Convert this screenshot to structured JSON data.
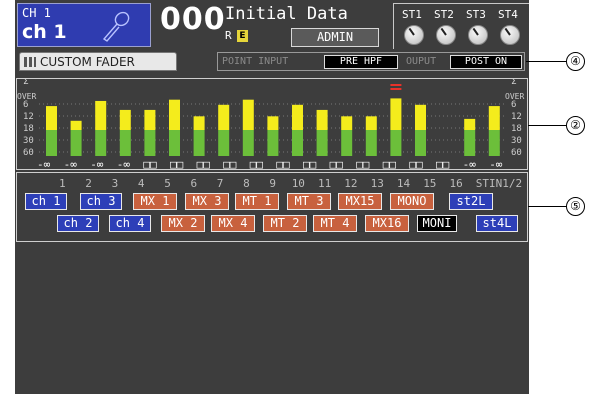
{
  "header": {
    "channel_number": "CH 1",
    "channel_name": "ch 1",
    "scene_number": "000",
    "scene_title": "Initial Data",
    "protect_mark": "R",
    "edit_badge": "E",
    "user_level": "ADMIN",
    "stereo_labels": [
      "ST1",
      "ST2",
      "ST3",
      "ST4"
    ]
  },
  "tab": {
    "label": "CUSTOM FADER"
  },
  "meter_point": {
    "input_label": "POINT INPUT",
    "input_value": "PRE HPF",
    "output_label": "OUPUT",
    "output_value": "POST ON"
  },
  "meter_scale": [
    "OVER",
    "6",
    "12",
    "18",
    "30",
    "60"
  ],
  "meter_scale_top": "Σ",
  "meters": {
    "levels": [
      0.78,
      0.55,
      0.86,
      0.72,
      0.72,
      0.88,
      0.62,
      0.8,
      0.88,
      0.62,
      0.8,
      0.72,
      0.62,
      0.62,
      0.9,
      0.8,
      0.0,
      0.58,
      0.78
    ],
    "peak_hold": [
      false,
      false,
      false,
      false,
      false,
      false,
      false,
      false,
      false,
      false,
      false,
      false,
      false,
      false,
      true,
      false,
      false,
      false,
      false
    ],
    "readouts": [
      "-∞",
      "-∞",
      "-∞",
      "-∞",
      "□□",
      "□□",
      "□□",
      "□□",
      "□□",
      "□□",
      "□□",
      "□□",
      "□□",
      "□□",
      "□□",
      "□□",
      "-∞",
      "-∞"
    ]
  },
  "channel_grid": {
    "numbers": [
      "1",
      "2",
      "3",
      "4",
      "5",
      "6",
      "7",
      "8",
      "9",
      "10",
      "11",
      "12",
      "13",
      "14",
      "15",
      "16",
      "STIN1/2"
    ],
    "row1": [
      "ch 1",
      "ch 3",
      "MX 1",
      "MX 3",
      "MT 1",
      "MT 3",
      "MX15",
      "MONO",
      "st2L"
    ],
    "row2": [
      "ch 2",
      "ch 4",
      "MX 2",
      "MX 4",
      "MT 2",
      "MT 4",
      "MX16",
      "MONI",
      "st4L"
    ]
  },
  "callouts": [
    "④",
    "②",
    "⑤"
  ],
  "colors": {
    "channel_blue": "#2d3fb8",
    "mix_orange": "#c8613e",
    "meter_yellow": "#f4ec1c",
    "meter_green": "#6cbf3a",
    "peak_red": "#e8322a",
    "background": "#3d3d3d"
  }
}
